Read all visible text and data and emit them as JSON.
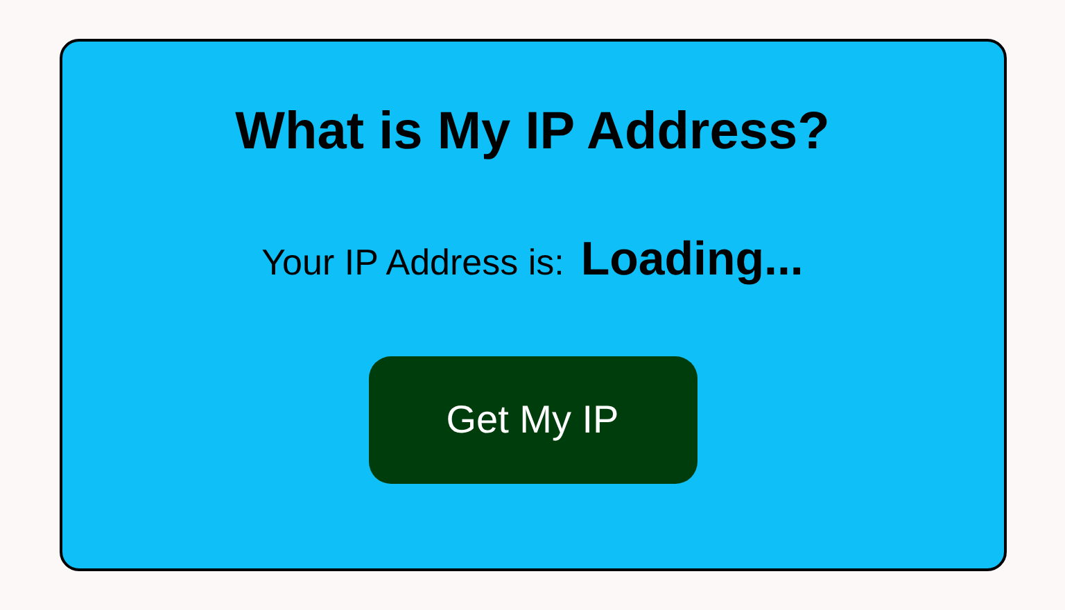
{
  "card": {
    "title": "What is My IP Address?",
    "label": "Your IP Address is:",
    "value": "Loading...",
    "button": "Get My IP"
  }
}
